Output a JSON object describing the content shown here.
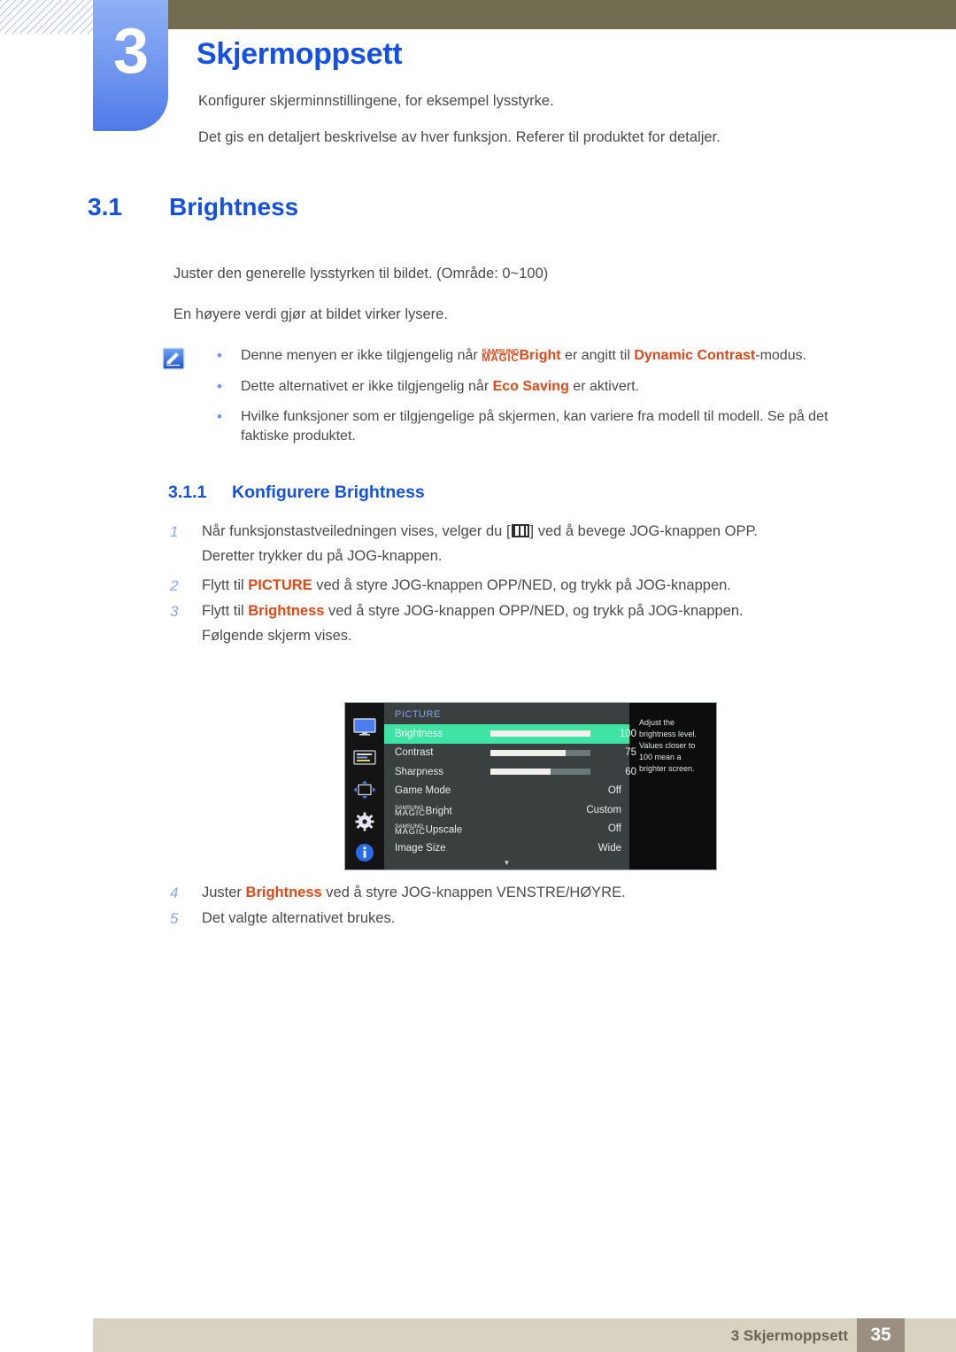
{
  "chapter": {
    "number": "3",
    "title": "Skjermoppsett",
    "intro_line1": "Konfigurer skjerminnstillingene, for eksempel lysstyrke.",
    "intro_line2": "Det gis en detaljert beskrivelse av hver funksjon. Referer til produktet for detaljer."
  },
  "section": {
    "number": "3.1",
    "title": "Brightness",
    "para1": "Juster den generelle lysstyrken til bildet. (Område: 0~100)",
    "para2": "En høyere verdi gjør at bildet virker lysere."
  },
  "note": {
    "icon": "note-pencil-icon",
    "items": [
      {
        "pre": "Denne menyen er ikke tilgjengelig når ",
        "magic_small": "SAMSUNG",
        "magic_large": "MAGIC",
        "magic_word": "Bright",
        "mid": " er angitt til ",
        "keyword": "Dynamic Contrast",
        "post": "-modus."
      },
      {
        "pre": "Dette alternativet er ikke tilgjengelig når ",
        "keyword": "Eco Saving",
        "post": " er aktivert."
      },
      {
        "pre": "Hvilke funksjoner som er tilgjengelige på skjermen, kan variere fra modell til modell. Se på det faktiske produktet."
      }
    ]
  },
  "subsection": {
    "number": "3.1.1",
    "title": "Konfigurere Brightness"
  },
  "steps": [
    {
      "num": "1",
      "pre": "Når funksjonstastveiledningen vises, velger du [",
      "icon": "menu-bars-icon",
      "post": "] ved å bevege JOG-knappen OPP.",
      "subline": "Deretter trykker du på JOG-knappen."
    },
    {
      "num": "2",
      "pre": "Flytt til ",
      "keyword": "PICTURE",
      "post": " ved å styre JOG-knappen OPP/NED, og trykk på JOG-knappen."
    },
    {
      "num": "3",
      "pre": "Flytt til ",
      "keyword": "Brightness",
      "post": " ved å styre JOG-knappen OPP/NED, og trykk på JOG-knappen.",
      "subline": "Følgende skjerm vises."
    },
    {
      "num": "4",
      "pre": "Juster ",
      "keyword": "Brightness",
      "post": " ved å styre JOG-knappen VENSTRE/HØYRE."
    },
    {
      "num": "5",
      "pre": "Det valgte alternativet brukes."
    }
  ],
  "osd": {
    "title": "PICTURE",
    "rail_icons": [
      "monitor-icon",
      "osd-display-icon",
      "resize-arrows-icon",
      "gear-icon",
      "info-icon"
    ],
    "rows": [
      {
        "label": "Brightness",
        "value": "100",
        "slider": 100,
        "selected": true
      },
      {
        "label": "Contrast",
        "value": "75",
        "slider": 75,
        "selected": false
      },
      {
        "label": "Sharpness",
        "value": "60",
        "slider": 60,
        "selected": false
      },
      {
        "label": "Game Mode",
        "value": "Off",
        "slider": null,
        "selected": false
      },
      {
        "label_small": "SAMSUNG",
        "label_large": "MAGIC",
        "label_suffix": "Bright",
        "value": "Custom",
        "slider": null,
        "selected": false
      },
      {
        "label_small": "SAMSUNG",
        "label_large": "MAGIC",
        "label_suffix": "Upscale",
        "value": "Off",
        "slider": null,
        "selected": false
      },
      {
        "label": "Image Size",
        "value": "Wide",
        "slider": null,
        "selected": false
      }
    ],
    "scroll_arrow": "▼",
    "tooltip": "Adjust the brightness level. Values closer to 100 mean a brighter screen.",
    "colors": {
      "highlight": "#3fe3a4",
      "title": "#7aa7f0",
      "panel": "#3a3f3f",
      "background": "#101010"
    }
  },
  "footer": {
    "text": "3 Skjermoppsett",
    "page": "35"
  },
  "theme": {
    "heading_blue": "#1450e8",
    "accent_red": "#e34718",
    "header_olive": "#716c4f",
    "footer_tan": "#d8d3c0",
    "footer_page_box": "#9b8f82"
  }
}
